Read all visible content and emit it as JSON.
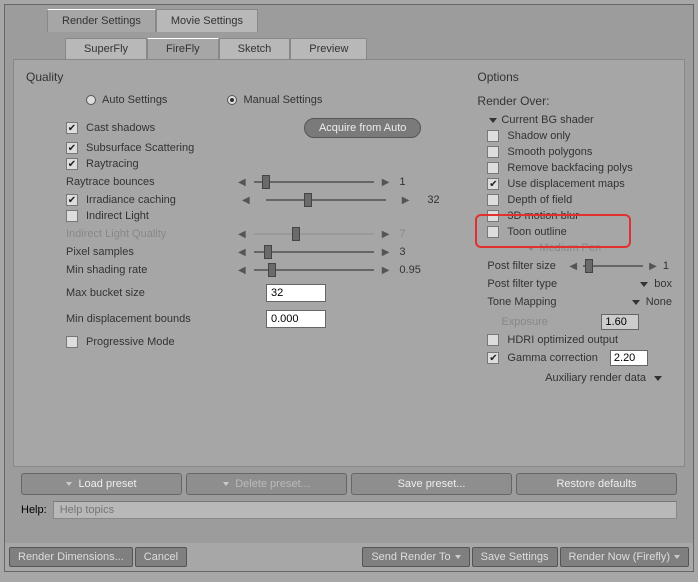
{
  "tabs_main": {
    "render_settings": "Render Settings",
    "movie_settings": "Movie Settings"
  },
  "tabs_sub": {
    "superfly": "SuperFly",
    "firefly": "FireFly",
    "sketch": "Sketch",
    "preview": "Preview"
  },
  "quality": {
    "title": "Quality",
    "auto": "Auto Settings",
    "manual": "Manual Settings",
    "cast_shadows": "Cast shadows",
    "acquire": "Acquire from Auto",
    "subsurface": "Subsurface Scattering",
    "raytracing": "Raytracing",
    "raytrace_bounces": "Raytrace bounces",
    "raytrace_bounces_val": "1",
    "irradiance": "Irradiance caching",
    "irradiance_val": "32",
    "indirect_light": "Indirect Light",
    "indirect_quality": "Indirect Light Quality",
    "indirect_quality_val": "7",
    "pixel_samples": "Pixel samples",
    "pixel_samples_val": "3",
    "min_shading": "Min shading rate",
    "min_shading_val": "0.95",
    "max_bucket": "Max bucket size",
    "max_bucket_val": "32",
    "min_disp": "Min displacement bounds",
    "min_disp_val": "0.000",
    "progressive": "Progressive Mode"
  },
  "options": {
    "title": "Options",
    "render_over": "Render Over:",
    "current_bg": "Current BG shader",
    "shadow_only": "Shadow only",
    "smooth_poly": "Smooth polygons",
    "remove_backfacing": "Remove backfacing polys",
    "use_displacement": "Use displacement maps",
    "depth_of_field": "Depth of field",
    "motion_blur": "3D motion blur",
    "toon_outline": "Toon outline",
    "medium_pen": "Medium Pen",
    "post_filter_size": "Post filter size",
    "post_filter_size_val": "1",
    "post_filter_type": "Post filter type",
    "post_filter_type_val": "box",
    "tone_mapping": "Tone Mapping",
    "tone_mapping_val": "None",
    "exposure": "Exposure",
    "exposure_val": "1.60",
    "hdri": "HDRI optimized output",
    "gamma": "Gamma correction",
    "gamma_val": "2.20",
    "aux": "Auxiliary render data"
  },
  "presets": {
    "load": "Load preset",
    "delete": "Delete preset...",
    "save": "Save preset...",
    "restore": "Restore defaults"
  },
  "help": {
    "label": "Help:",
    "placeholder": "Help topics"
  },
  "bottom": {
    "dims": "Render Dimensions...",
    "cancel": "Cancel",
    "send": "Send Render To",
    "save": "Save Settings",
    "now": "Render Now (Firefly)"
  }
}
